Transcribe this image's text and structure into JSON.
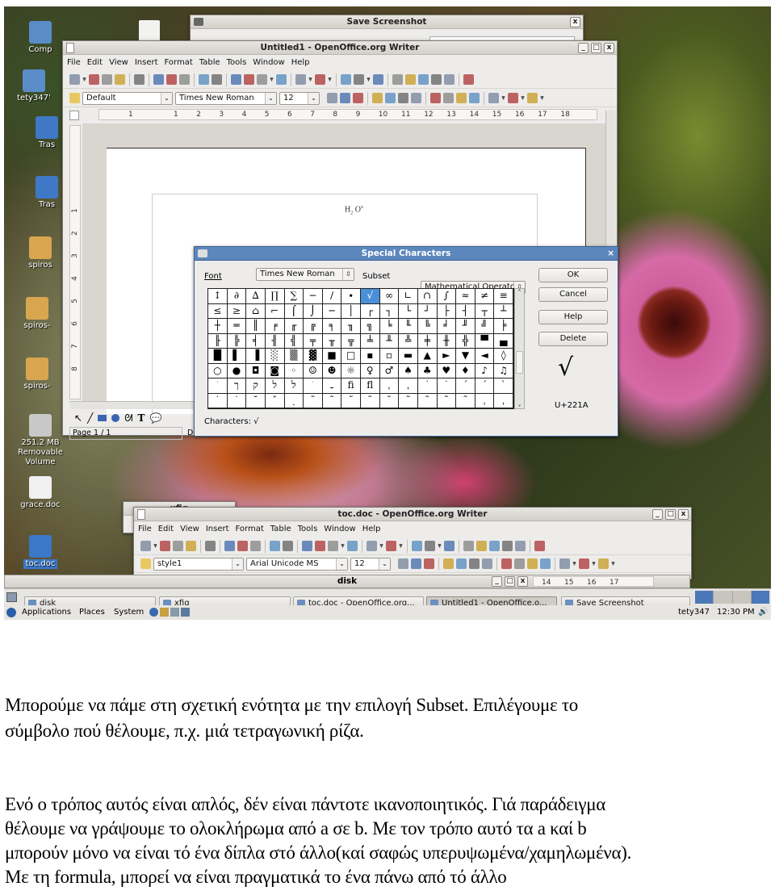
{
  "desktop_icons": [
    {
      "label": "Comp",
      "color": "#5a8cc8"
    },
    {
      "label": "tety347'",
      "color": "#5a8cc8"
    },
    {
      "label": "Tras",
      "color": "#3f78c4"
    },
    {
      "label": "Tras",
      "color": "#3f78c4"
    },
    {
      "label": "spiros",
      "color": "#d9a650"
    },
    {
      "label": "spiros-",
      "color": "#d9a650"
    },
    {
      "label": "spiros-",
      "color": "#d9a650"
    },
    {
      "label": "251.2 MB\nRemovable Volume",
      "color": "#c8c8c8"
    },
    {
      "label": "grace.doc",
      "color": "#f0f0f0"
    },
    {
      "label": "toc.doc",
      "color": "#3a78c8"
    }
  ],
  "save_screenshot": {
    "title": "Save Screenshot",
    "close": "x"
  },
  "writer1": {
    "title": "Untitled1 - OpenOffice.org Writer",
    "menu": [
      "File",
      "Edit",
      "View",
      "Insert",
      "Format",
      "Table",
      "Tools",
      "Window",
      "Help"
    ],
    "toolbar_icons": [
      "new-icon",
      "dropdown",
      "open-icon",
      "save-icon",
      "email-icon",
      "sep",
      "edit-file-icon",
      "sep",
      "pdf-icon",
      "print-icon",
      "print-preview-icon",
      "sep",
      "spellcheck-icon",
      "autospell-icon",
      "sep",
      "cut-icon",
      "copy-icon",
      "paste-icon",
      "dropdown",
      "paintbrush-icon",
      "sep",
      "undo-icon",
      "dropdown",
      "redo-icon",
      "dropdown",
      "sep",
      "hyperlink-icon",
      "table-icon",
      "dropdown",
      "draw-icon",
      "sep",
      "navigator-icon",
      "gallery-icon",
      "datasource-icon",
      "pilcrow-icon",
      "zoom-icon",
      "sep",
      "help-icon"
    ],
    "style": "Default",
    "font": "Times New Roman",
    "size": "12",
    "format_icons": [
      "bold-icon",
      "italic-icon",
      "underline-icon",
      "sep",
      "align-left-icon",
      "align-center-icon",
      "align-right-icon",
      "justify-icon",
      "sep",
      "numbering-icon",
      "bullets-icon",
      "decrease-indent-icon",
      "increase-indent-icon",
      "sep",
      "font-color-icon",
      "dropdown",
      "highlight-icon",
      "dropdown",
      "background-color-icon",
      "dropdown"
    ],
    "ruler": [
      "1",
      "1",
      "2",
      "3",
      "4",
      "5",
      "6",
      "7",
      "8",
      "9",
      "10",
      "11",
      "12",
      "13",
      "14",
      "15",
      "16",
      "17",
      "18"
    ],
    "vruler": [
      "1",
      "2",
      "3",
      "4",
      "5",
      "6",
      "7",
      "8"
    ],
    "doc_text": {
      "base": "H",
      "sub": "2",
      "base2": "O",
      "sup": "x"
    },
    "status": {
      "page": "Page 1 / 1",
      "style": "De"
    }
  },
  "special_chars": {
    "title": "Special Characters",
    "font_label": "Font",
    "font_value": "Times New Roman",
    "subset_label": "Subset",
    "subset_value": "Mathematical Operator",
    "buttons": {
      "ok": "OK",
      "cancel": "Cancel",
      "help": "Help",
      "delete": "Delete"
    },
    "grid": [
      [
        "↕",
        "∂",
        "∆",
        "∏",
        "∑",
        "−",
        "∕",
        "∙",
        "√",
        "∞",
        "∟",
        "∩",
        "∫",
        "≈",
        "≠",
        "≡"
      ],
      [
        "≤",
        "≥",
        "⌂",
        "⌐",
        "⌠",
        "⌡",
        "─",
        "│",
        "┌",
        "┐",
        "└",
        "┘",
        "├",
        "┤",
        "┬",
        "┴"
      ],
      [
        "┼",
        "═",
        "║",
        "╒",
        "╓",
        "╔",
        "╕",
        "╖",
        "╗",
        "╘",
        "╙",
        "╚",
        "╛",
        "╜",
        "╝",
        "╞"
      ],
      [
        "╟",
        "╠",
        "╡",
        "╢",
        "╣",
        "╤",
        "╥",
        "╦",
        "╧",
        "╨",
        "╩",
        "╪",
        "╫",
        "╬",
        "▀",
        "▄"
      ],
      [
        "█",
        "▌",
        "▐",
        "░",
        "▒",
        "▓",
        "■",
        "□",
        "▪",
        "▫",
        "▬",
        "▲",
        "►",
        "▼",
        "◄",
        "◊"
      ],
      [
        "○",
        "●",
        "◘",
        "◙",
        "◦",
        "☺",
        "☻",
        "☼",
        "♀",
        "♂",
        "♠",
        "♣",
        "♥",
        "♦",
        "♪",
        "♫"
      ],
      [
        "ֹ",
        "ך",
        "ק",
        "ל",
        "ל",
        "ׂ",
        "ـ",
        "ﬁ",
        "ﬂ",
        "ˌ",
        "ˌ",
        "˙",
        "˙",
        "ˊ",
        "ˊ",
        "ˋ"
      ],
      [
        "˙",
        "˙",
        "˘",
        "ˇ",
        "ˏ",
        "˜",
        "˜",
        "˜",
        "˜",
        "˜",
        "˜",
        "˜",
        "˜",
        "˜",
        "ˌ",
        "ˌ"
      ]
    ],
    "selected": "√",
    "codepoint": "U+221A",
    "characters_label": "Characters:",
    "characters_value": "√",
    "title_color": "#5b87bd"
  },
  "xfig": {
    "title": "xfig"
  },
  "writer2": {
    "title": "toc.doc - OpenOffice.org Writer",
    "menu": [
      "File",
      "Edit",
      "View",
      "Insert",
      "Format",
      "Table",
      "Tools",
      "Window",
      "Help"
    ],
    "style": "style1",
    "font": "Arial Unicode MS",
    "size": "12",
    "ruler": [
      "14",
      "15",
      "16",
      "17"
    ]
  },
  "disk_window": {
    "title": "disk"
  },
  "taskbar": [
    {
      "label": "disk",
      "active": false
    },
    {
      "label": "xfig",
      "active": false
    },
    {
      "label": "toc.doc - OpenOffice.org...",
      "active": false
    },
    {
      "label": "Untitled1 - OpenOffice.o...",
      "active": true
    },
    {
      "label": "Save Screenshot",
      "active": false
    }
  ],
  "panel": {
    "applications": "Applications",
    "places": "Places",
    "system": "System",
    "user": "tety347",
    "clock": "12:30 PM"
  },
  "paragraphs": [
    [
      "Μπορούμε να πάμε στη σχετική ενότητα  με την επιλογή Subset. Επιλέγουμε το",
      "σύμβολο πού θέλουμε, π.χ. μιά τετραγωνική ρίζα."
    ],
    [
      "Ενό ο τρόπος αυτός είναι απλός, δέν είναι  πάντοτε ικανοποιητικός. Γιά παράδειγμα",
      "θέλουμε να γράψουμε  το ολοκλήρωμα από a σε b. Με τον τρόπο αυτό τα a καί  b",
      "μπορούν μόνο να είναι τό ένα δίπλα στό άλλο(καί σαφώς υπερυψωμένα/χαμηλωμένα).",
      "Με τη formula, μπορεί να είναι πραγματικά το ένα πάνω από τό άλλο"
    ]
  ]
}
